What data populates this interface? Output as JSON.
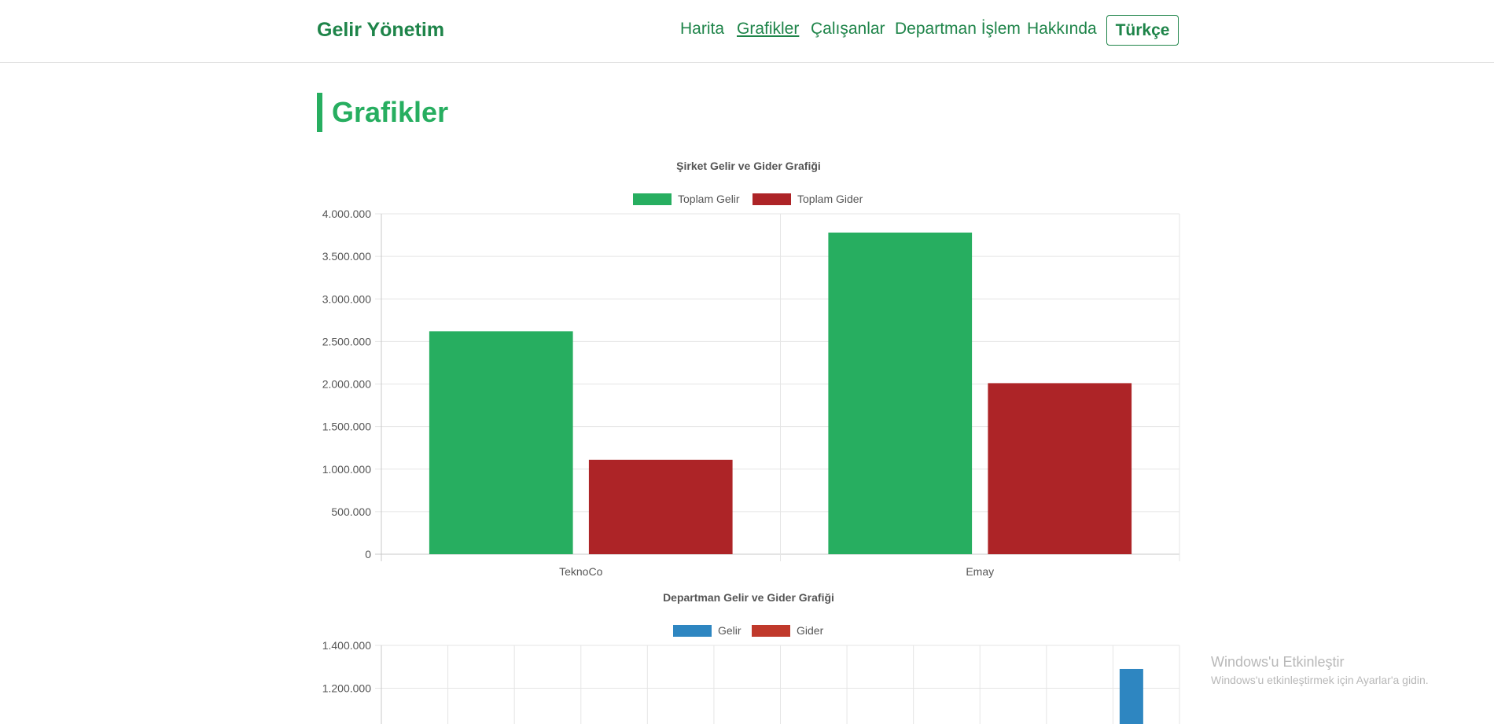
{
  "app": {
    "brand": "Gelir Yönetim",
    "nav": [
      {
        "label": "Harita",
        "active": false
      },
      {
        "label": "Grafikler",
        "active": true
      },
      {
        "label": "Çalışanlar",
        "active": false
      },
      {
        "label": "Departman İşlem",
        "active": false
      },
      {
        "label": "Hakkında",
        "active": false
      }
    ],
    "language_button": "Türkçe"
  },
  "page": {
    "title": "Grafikler"
  },
  "watermark": {
    "title": "Windows'u Etkinleştir",
    "subtitle": "Windows'u etkinleştirmek için Ayarlar'a gidin."
  },
  "chart_data": [
    {
      "type": "bar",
      "title": "Şirket Gelir ve Gider Grafiği",
      "categories": [
        "TeknoCo",
        "Emay"
      ],
      "series": [
        {
          "name": "Toplam Gelir",
          "color": "#27ae60",
          "values": [
            2620000,
            3780000
          ]
        },
        {
          "name": "Toplam Gider",
          "color": "#ad2427",
          "values": [
            1110000,
            2010000
          ]
        }
      ],
      "ylim": [
        0,
        4000000
      ],
      "yticks": [
        "0",
        "500.000",
        "1.000.000",
        "1.500.000",
        "2.000.000",
        "2.500.000",
        "3.000.000",
        "3.500.000",
        "4.000.000"
      ],
      "legend": "top",
      "grid": true
    },
    {
      "type": "bar",
      "title": "Departman Gelir ve Gider Grafiği",
      "legend_entries": [
        {
          "name": "Gelir",
          "color": "#2e86c1"
        },
        {
          "name": "Gider",
          "color": "#c0392b"
        }
      ],
      "yticks_visible": [
        "1.400.000",
        "1.200.000"
      ],
      "visible_bar": {
        "series": "Gelir",
        "value": 1290000
      },
      "legend": "top",
      "grid": true
    }
  ]
}
